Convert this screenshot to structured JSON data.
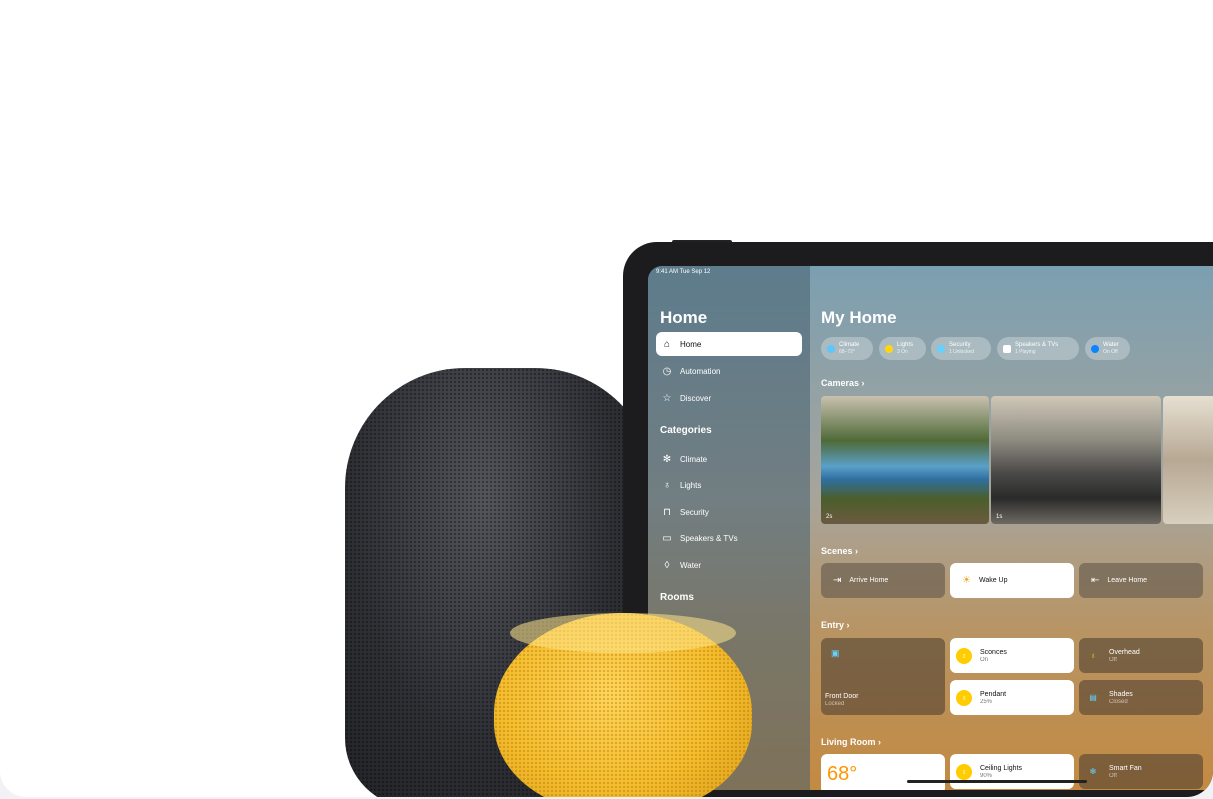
{
  "status_bar": "9:41 AM   Tue Sep 12",
  "sidebar": {
    "title": "Home",
    "items": [
      {
        "label": "Home",
        "icon": "house-icon",
        "glyph": "⌂"
      },
      {
        "label": "Automation",
        "icon": "clock-icon",
        "glyph": "◷"
      },
      {
        "label": "Discover",
        "icon": "star-icon",
        "glyph": "☆"
      }
    ],
    "categories_heading": "Categories",
    "categories": [
      {
        "label": "Climate",
        "icon": "fan-icon",
        "glyph": "✻"
      },
      {
        "label": "Lights",
        "icon": "lightbulb-icon",
        "glyph": "♁"
      },
      {
        "label": "Security",
        "icon": "lock-icon",
        "glyph": "⊓"
      },
      {
        "label": "Speakers & TVs",
        "icon": "tv-icon",
        "glyph": "▭"
      },
      {
        "label": "Water",
        "icon": "drop-icon",
        "glyph": "◊"
      }
    ],
    "rooms_heading": "Rooms"
  },
  "main": {
    "title": "My Home",
    "chips": [
      {
        "label": "Climate",
        "sub": "68–72°",
        "color": "#5ac8fa"
      },
      {
        "label": "Lights",
        "sub": "3 On",
        "color": "#ffd60a"
      },
      {
        "label": "Security",
        "sub": "1 Unlocked",
        "color": "#64d2ff"
      },
      {
        "label": "Speakers & TVs",
        "sub": "1 Playing",
        "color": "#ffffff"
      },
      {
        "label": "Water",
        "sub": "On Off",
        "color": "#0a84ff"
      }
    ],
    "cameras_heading": "Cameras ›",
    "cameras": [
      {
        "label": "2s"
      },
      {
        "label": "1s"
      },
      {
        "label": ""
      }
    ],
    "scenes_heading": "Scenes ›",
    "scenes": [
      {
        "label": "Arrive Home",
        "icon": "walk-in-icon",
        "glyph": "⇥"
      },
      {
        "label": "Wake Up",
        "icon": "sunrise-icon",
        "glyph": "☀"
      },
      {
        "label": "Leave Home",
        "icon": "walk-out-icon",
        "glyph": "⇤"
      }
    ],
    "entry_heading": "Entry ›",
    "entry": {
      "front_door": {
        "label": "Front Door",
        "sub": "Locked"
      },
      "sconces": {
        "label": "Sconces",
        "sub": "On"
      },
      "overhead": {
        "label": "Overhead",
        "sub": "Off"
      },
      "pendant": {
        "label": "Pendant",
        "sub": "25%"
      },
      "shades": {
        "label": "Shades",
        "sub": "Closed"
      }
    },
    "living_heading": "Living Room ›",
    "living": {
      "temp": "68°",
      "ceiling": {
        "label": "Ceiling Lights",
        "sub": "90%"
      },
      "fan": {
        "label": "Smart Fan",
        "sub": "Off"
      }
    }
  }
}
